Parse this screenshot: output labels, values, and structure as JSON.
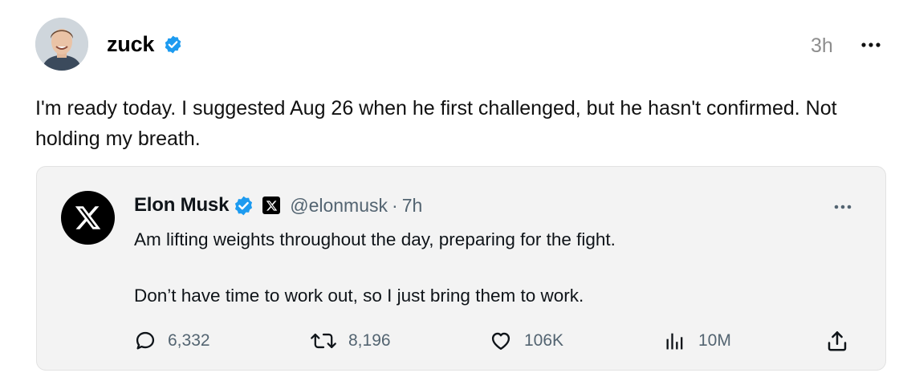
{
  "post": {
    "author": "zuck",
    "timestamp": "3h",
    "text": "I'm ready today. I suggested Aug 26 when he first challenged, but he hasn't confirmed. Not holding my breath."
  },
  "quoted": {
    "name": "Elon Musk",
    "handle": "@elonmusk",
    "separator": "·",
    "time": "7h",
    "line1": "Am lifting weights throughout the day, preparing for the fight.",
    "line2": "Don’t have time to work out, so I just bring them to work.",
    "stats": {
      "replies": "6,332",
      "reposts": "8,196",
      "likes": "106K",
      "views": "10M"
    }
  },
  "icons": {
    "verified": "verified-badge-icon",
    "more": "more-horizontal-icon",
    "x_logo": "x-logo-icon",
    "reply": "reply-bubble-icon",
    "repost": "repost-icon",
    "like": "heart-icon",
    "views": "views-bar-chart-icon",
    "share": "share-upload-icon"
  },
  "colors": {
    "verified_blue": "#1d9bf0",
    "secondary_text": "#536471",
    "card_background": "#f3f3f3"
  }
}
